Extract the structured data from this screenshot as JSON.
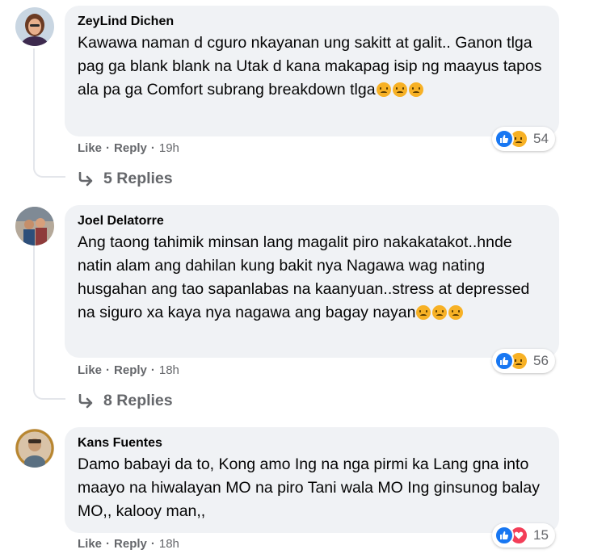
{
  "comments": [
    {
      "author": "ZeyLind Dichen",
      "text": "Kawawa naman d cguro nkayanan ung sakitt at galit.. Ganon tlga pag ga blank blank na Utak d kana makapag isip ng maayus tapos ala pa ga Comfort subrang breakdown tlga",
      "emoji_name": "sad-face-emoji",
      "reaction_types": [
        "like",
        "sad"
      ],
      "reaction_count": "54",
      "like_label": "Like",
      "reply_label": "Reply",
      "time": "19h",
      "replies_label": "5 Replies"
    },
    {
      "author": "Joel Delatorre",
      "text": "Ang taong tahimik minsan lang magalit piro nakakatakot..hnde natin alam ang dahilan kung bakit nya Nagawa wag nating husgahan ang tao sapanlabas na kaanyuan..stress at depressed na siguro xa kaya nya nagawa ang bagay nayan",
      "emoji_name": "sad-face-emoji",
      "reaction_types": [
        "like",
        "sad"
      ],
      "reaction_count": "56",
      "like_label": "Like",
      "reply_label": "Reply",
      "time": "18h",
      "replies_label": "8 Replies"
    },
    {
      "author": "Kans Fuentes",
      "text": "Damo babayi da to, Kong amo Ing na nga pirmi ka Lang gna into maayo na hiwalayan MO na piro Tani wala MO Ing ginsunog balay MO,, kalooy man,,",
      "reaction_types": [
        "like",
        "love"
      ],
      "reaction_count": "15",
      "like_label": "Like",
      "reply_label": "Reply",
      "time": "18h"
    }
  ],
  "colors": {
    "bubble": "#f0f2f5",
    "meta_text": "#65676b",
    "like_blue": "#1877f2",
    "sad_yellow": "#f7b125",
    "love_red": "#f33e58"
  }
}
